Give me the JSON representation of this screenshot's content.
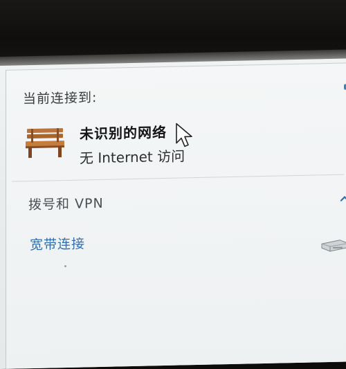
{
  "popup": {
    "current_connection_heading": "当前连接到:",
    "network": {
      "name": "未识别的网络",
      "status": "无 Internet 访问",
      "icon": "bench-network-icon"
    },
    "dialup_section": {
      "title": "拨号和 VPN",
      "connection_label": "宽带连接",
      "connection_icon": "modem-icon"
    }
  },
  "colors": {
    "link": "#2e6fb3",
    "panel_bg": "#eef1f2"
  }
}
